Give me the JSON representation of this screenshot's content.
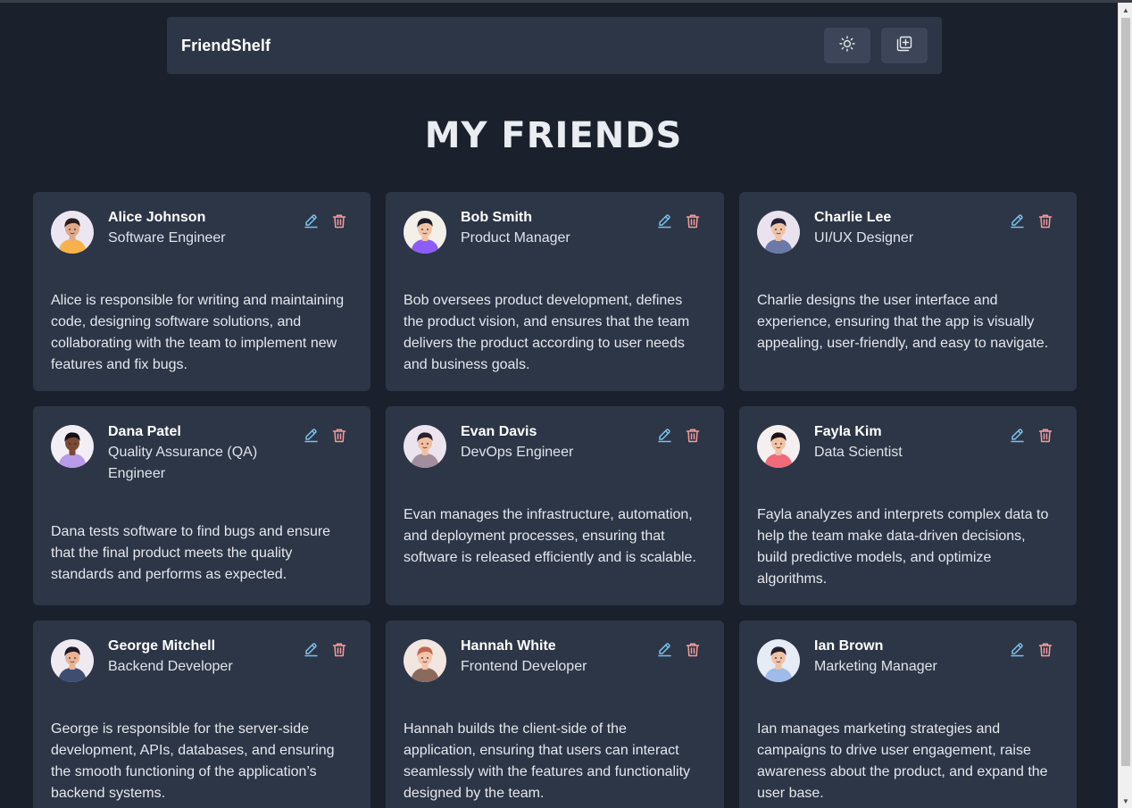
{
  "brand": "FriendShelf",
  "nav": {
    "theme_icon": "sun-icon",
    "add_icon": "add-friend-icon"
  },
  "heading": "MY FRIENDS",
  "friends": [
    {
      "name": "Alice Johnson",
      "role": "Software Engineer",
      "description": "Alice is responsible for writing and maintaining code, designing software solutions, and collaborating with the team to implement new features and fix bugs.",
      "avatar": {
        "bg": "#ece6f2",
        "skin": "#e0a98a",
        "hair": "#2b1d1a",
        "shirt": "#f7b34a"
      }
    },
    {
      "name": "Bob Smith",
      "role": "Product Manager",
      "description": "Bob oversees product development, defines the product vision, and ensures that the team delivers the product according to user needs and business goals.",
      "avatar": {
        "bg": "#f3efe9",
        "skin": "#f1c3a6",
        "hair": "#1d1d2a",
        "shirt": "#8d5cf6"
      }
    },
    {
      "name": "Charlie Lee",
      "role": "UI/UX Designer",
      "description": "Charlie designs the user interface and experience, ensuring that the app is visually appealing, user-friendly, and easy to navigate.",
      "avatar": {
        "bg": "#e8e3ef",
        "skin": "#f0c2a4",
        "hair": "#262033",
        "shirt": "#6c78a8"
      }
    },
    {
      "name": "Dana Patel",
      "role": "Quality Assurance (QA) Engineer",
      "description": "Dana tests software to find bugs and ensure that the final product meets the quality standards and performs as expected.",
      "avatar": {
        "bg": "#f2eef6",
        "skin": "#7a4a35",
        "hair": "#141018",
        "shirt": "#b99ae8"
      }
    },
    {
      "name": "Evan Davis",
      "role": "DevOps Engineer",
      "description": "Evan manages the infrastructure, automation, and deployment processes, ensuring that software is released efficiently and is scalable.",
      "avatar": {
        "bg": "#ebe4ee",
        "skin": "#f0bfa2",
        "hair": "#2a2030",
        "shirt": "#a38e9e"
      }
    },
    {
      "name": "Fayla Kim",
      "role": "Data Scientist",
      "description": "Fayla analyzes and interprets complex data to help the team make data-driven decisions, build predictive models, and optimize algorithms.",
      "avatar": {
        "bg": "#f5f0ef",
        "skin": "#f2c2a3",
        "hair": "#1c1418",
        "shirt": "#f06a7a"
      }
    },
    {
      "name": "George Mitchell",
      "role": "Backend Developer",
      "description": "George is responsible for the server-side development, APIs, databases, and ensuring the smooth functioning of the application’s backend systems.",
      "avatar": {
        "bg": "#efe9f1",
        "skin": "#e9b596",
        "hair": "#211a28",
        "shirt": "#3f4d70"
      }
    },
    {
      "name": "Hannah White",
      "role": "Frontend Developer",
      "description": "Hannah builds the client-side of the application, ensuring that users can interact seamlessly with the features and functionality designed by the team.",
      "avatar": {
        "bg": "#f2e6e1",
        "skin": "#f2c5aa",
        "hair": "#c4664f",
        "shirt": "#8b6a5e"
      }
    },
    {
      "name": "Ian Brown",
      "role": "Marketing Manager",
      "description": "Ian manages marketing strategies and campaigns to drive user engagement, raise awareness about the product, and expand the user base.",
      "avatar": {
        "bg": "#e6ecf6",
        "skin": "#f0c2a4",
        "hair": "#23202c",
        "shirt": "#9fbbe8"
      }
    }
  ],
  "colors": {
    "edit": "#7cc0ea",
    "delete": "#f49a9a"
  }
}
